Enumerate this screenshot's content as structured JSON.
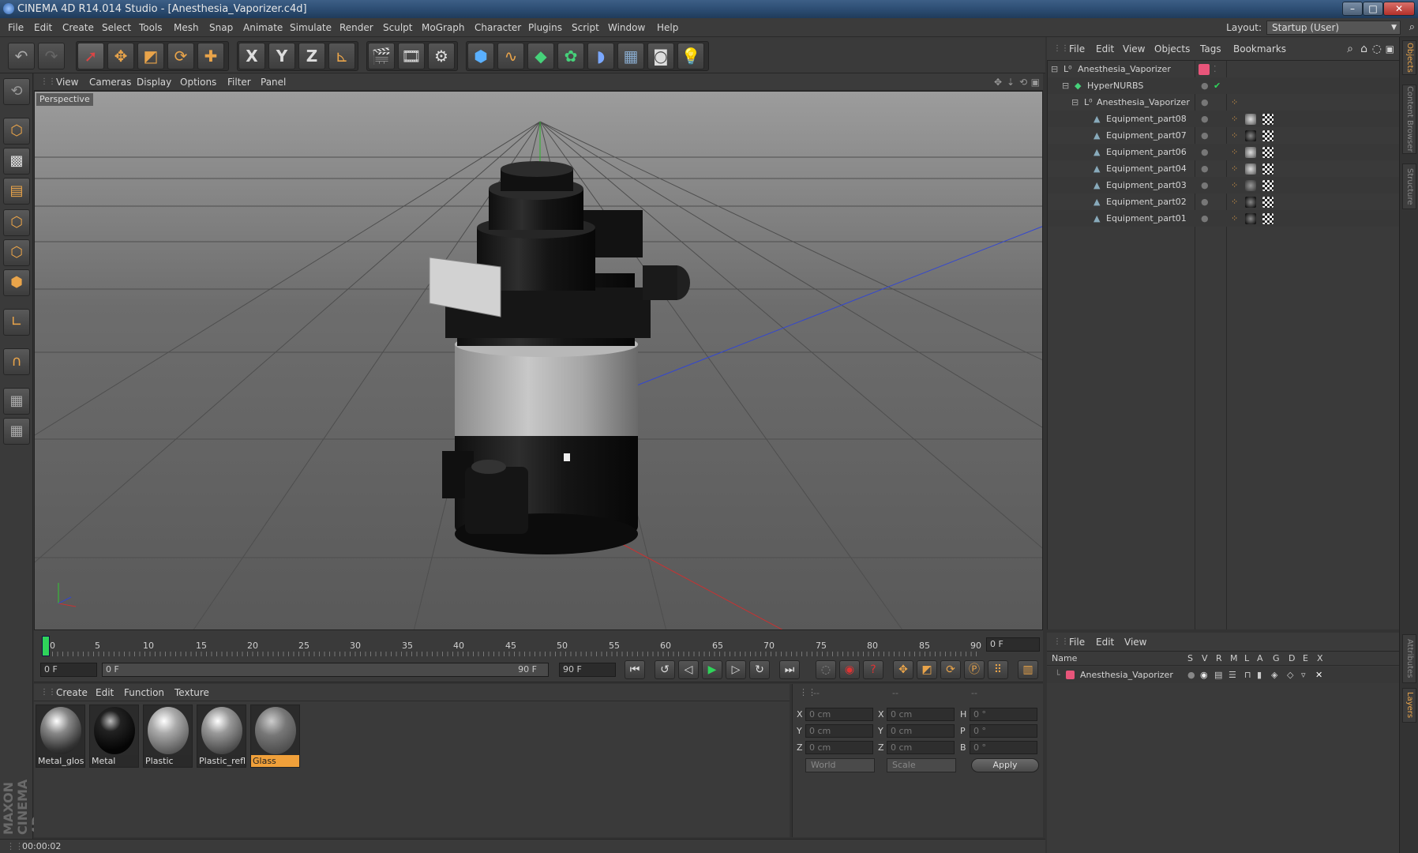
{
  "window": {
    "title": "CINEMA 4D R14.014 Studio - [Anesthesia_Vaporizer.c4d]",
    "min": "–",
    "max": "□",
    "close": "✕"
  },
  "menubar": {
    "items": [
      "File",
      "Edit",
      "Create",
      "Select",
      "Tools",
      "Mesh",
      "Snap",
      "Animate",
      "Simulate",
      "Render",
      "Sculpt",
      "MoGraph",
      "Character",
      "Plugins",
      "Script",
      "Window",
      "Help"
    ],
    "layout_label": "Layout:",
    "layout_value": "Startup (User)"
  },
  "toolbar": {
    "icons": [
      "undo-icon",
      "redo-icon",
      "live-selection-icon",
      "move-icon",
      "scale-icon",
      "rotate-icon",
      "last-tool-icon",
      "x-axis-icon",
      "y-axis-icon",
      "z-axis-icon",
      "coordinate-system-icon",
      "render-view-icon",
      "render-picture-viewer-icon",
      "edit-render-settings-icon",
      "cube-icon",
      "spline-pen-icon",
      "subdivision-icon",
      "array-icon",
      "deformer-icon",
      "floor-icon",
      "camera-icon",
      "light-icon"
    ],
    "axis_labels": [
      "X",
      "Y",
      "Z"
    ]
  },
  "viewport": {
    "menu": [
      "View",
      "Cameras",
      "Display",
      "Options",
      "Filter",
      "Panel"
    ],
    "label": "Perspective"
  },
  "timeline": {
    "ticks": [
      "0",
      "5",
      "10",
      "15",
      "20",
      "25",
      "30",
      "35",
      "40",
      "45",
      "50",
      "55",
      "60",
      "65",
      "70",
      "75",
      "80",
      "85",
      "90"
    ],
    "current_frame": "0 F"
  },
  "transport": {
    "start": "0 F",
    "range_start": "0 F",
    "range_end": "90 F",
    "end": "90 F"
  },
  "materials": {
    "menu": [
      "Create",
      "Edit",
      "Function",
      "Texture"
    ],
    "items": [
      {
        "name": "Metal_glos",
        "selected": false
      },
      {
        "name": "Metal",
        "selected": false
      },
      {
        "name": "Plastic",
        "selected": false
      },
      {
        "name": "Plastic_refl",
        "selected": false
      },
      {
        "name": "Glass",
        "selected": true
      }
    ]
  },
  "coordinates": {
    "headers": [
      "--",
      "--",
      "--"
    ],
    "rows": [
      {
        "a": "X",
        "av": "0 cm",
        "b": "X",
        "bv": "0 cm",
        "c": "H",
        "cv": "0 °"
      },
      {
        "a": "Y",
        "av": "0 cm",
        "b": "Y",
        "bv": "0 cm",
        "c": "P",
        "cv": "0 °"
      },
      {
        "a": "Z",
        "av": "0 cm",
        "b": "Z",
        "bv": "0 cm",
        "c": "B",
        "cv": "0 °"
      }
    ],
    "mode": "World",
    "scale": "Scale",
    "apply": "Apply"
  },
  "status": {
    "time": "00:00:02"
  },
  "objects": {
    "menu": [
      "File",
      "Edit",
      "View",
      "Objects",
      "Tags",
      "Bookmarks"
    ],
    "tree": [
      {
        "name": "Anesthesia_Vaporizer",
        "indent": 0
      },
      {
        "name": "HyperNURBS",
        "indent": 1
      },
      {
        "name": "Anesthesia_Vaporizer",
        "indent": 2
      },
      {
        "name": "Equipment_part08",
        "indent": 3
      },
      {
        "name": "Equipment_part07",
        "indent": 3
      },
      {
        "name": "Equipment_part06",
        "indent": 3
      },
      {
        "name": "Equipment_part04",
        "indent": 3
      },
      {
        "name": "Equipment_part03",
        "indent": 3
      },
      {
        "name": "Equipment_part02",
        "indent": 3
      },
      {
        "name": "Equipment_part01",
        "indent": 3
      }
    ]
  },
  "layers": {
    "menu": [
      "File",
      "Edit",
      "View"
    ],
    "columns": [
      "Name",
      "S",
      "V",
      "R",
      "M",
      "L",
      "A",
      "G",
      "D",
      "E",
      "X"
    ],
    "rows": [
      {
        "name": "Anesthesia_Vaporizer",
        "color": "#e8557a"
      }
    ]
  },
  "right_tabs": [
    "Objects",
    "Content Browser",
    "Structure",
    "Attributes",
    "Layers"
  ],
  "colors": {
    "accent": "#f0a03a",
    "playhead": "#2fd35a",
    "x_axis": "#c83232",
    "y_axis": "#32c832",
    "z_axis": "#3246d2"
  },
  "branding": {
    "logo": "MAXON CINEMA 4D"
  }
}
